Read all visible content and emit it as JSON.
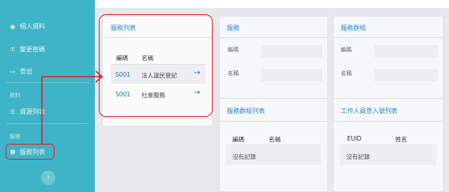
{
  "sidebar": {
    "items": [
      {
        "label": "個人資料",
        "icon": "user-icon"
      },
      {
        "label": "變更密碼",
        "icon": "key-icon"
      },
      {
        "label": "登出",
        "icon": "logout-icon"
      }
    ],
    "sections": [
      {
        "title": "資料",
        "items": [
          {
            "label": "資源列表",
            "icon": "list-icon"
          }
        ]
      },
      {
        "title": "服務",
        "items": [
          {
            "label": "服務列表",
            "icon": "users-icon"
          }
        ]
      }
    ],
    "collapse_icon": "chevron-left-icon"
  },
  "service_list": {
    "title": "服務列表",
    "columns": [
      "編碼",
      "名稱"
    ],
    "rows": [
      {
        "code": "S001",
        "name": "法人違民登記",
        "action_icon": "arrow-right-icon"
      },
      {
        "code": "S001",
        "name": "社會服務",
        "action_icon": "arrow-right-icon"
      }
    ]
  },
  "service_detail": {
    "title": "服務",
    "fields": [
      {
        "label": "編碼",
        "value": ""
      },
      {
        "label": "名稱",
        "value": ""
      }
    ]
  },
  "service_group_detail": {
    "title": "服務群組",
    "fields": [
      {
        "label": "編碼",
        "value": ""
      },
      {
        "label": "名稱",
        "value": ""
      }
    ]
  },
  "service_group_list": {
    "title": "服務群組列表",
    "columns": [
      "編碼",
      "名稱"
    ],
    "empty_text": "沒有記錄"
  },
  "staff_login_list": {
    "title": "工作人員登入號列表",
    "columns": [
      "EUID",
      "姓名"
    ],
    "empty_text": "沒有記錄"
  },
  "colors": {
    "sidebar": "#3fb4c7",
    "accent": "#2a89c6",
    "highlight": "#e0222c"
  }
}
